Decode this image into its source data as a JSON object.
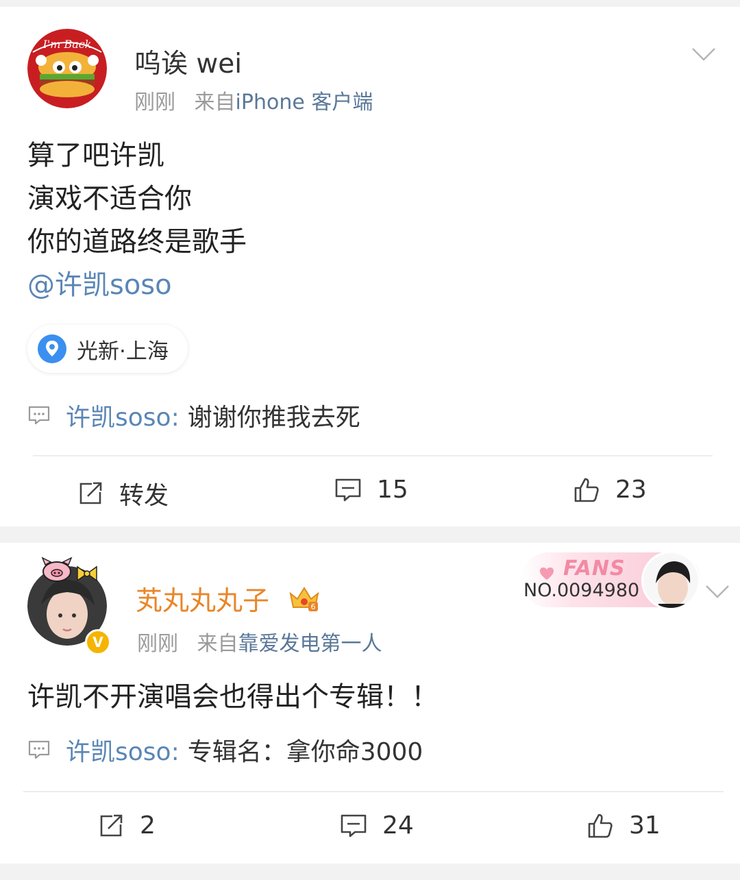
{
  "posts": [
    {
      "username": "呜诶 wei",
      "avatar_text": "I'm Back",
      "time": "刚刚",
      "from_prefix": "来自",
      "source": "iPhone 客户端",
      "text_lines": [
        "算了吧许凯",
        "演戏不适合你",
        "你的道路终是歌手"
      ],
      "mention": "@许凯soso",
      "location": "光新·上海",
      "comment": {
        "user": "许凯soso:",
        "text": "谢谢你推我去死"
      },
      "actions": {
        "repost": "转发",
        "comments": "15",
        "likes": "23"
      }
    },
    {
      "username": "芄丸丸丸子",
      "time": "刚刚",
      "from_prefix": "来自",
      "source": "靠爱发电第一人",
      "text_lines": [
        "许凯不开演唱会也得出个专辑！！"
      ],
      "comment": {
        "user": "许凯soso:",
        "text": "专辑名：拿你命3000"
      },
      "fans_badge": {
        "title": "FANS",
        "number": "NO.0094980"
      },
      "verified_mark": "V",
      "vip_level": "6",
      "actions": {
        "repost": "2",
        "comments": "24",
        "likes": "31"
      }
    }
  ],
  "icons": {
    "menu": "chevron-down-icon",
    "repost": "repost-icon",
    "comment": "comment-icon",
    "like": "thumbs-up-icon",
    "location": "location-pin-icon"
  },
  "colors": {
    "link": "#5a86b6",
    "username_vip": "#e8862a",
    "meta": "#9a9a9a",
    "location_pin": "#3b8ff0"
  }
}
